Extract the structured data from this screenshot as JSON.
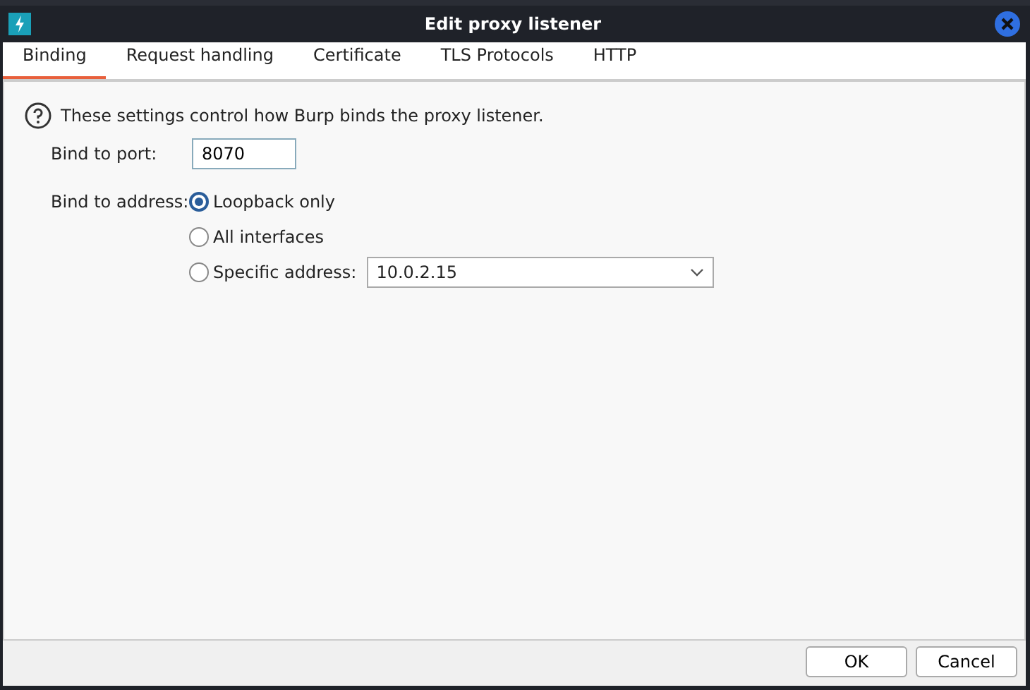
{
  "window": {
    "title": "Edit proxy listener"
  },
  "tabs": [
    {
      "label": "Binding",
      "selected": true
    },
    {
      "label": "Request handling",
      "selected": false
    },
    {
      "label": "Certificate",
      "selected": false
    },
    {
      "label": "TLS Protocols",
      "selected": false
    },
    {
      "label": "HTTP",
      "selected": false
    }
  ],
  "info": "These settings control how Burp binds the proxy listener.",
  "port": {
    "label": "Bind to port:",
    "value": "8070"
  },
  "address": {
    "label": "Bind to address:",
    "options": [
      {
        "label": "Loopback only",
        "selected": true
      },
      {
        "label": "All interfaces",
        "selected": false
      },
      {
        "label": "Specific address:",
        "selected": false,
        "dropdown": "10.0.2.15"
      }
    ]
  },
  "buttons": [
    "OK",
    "Cancel"
  ]
}
